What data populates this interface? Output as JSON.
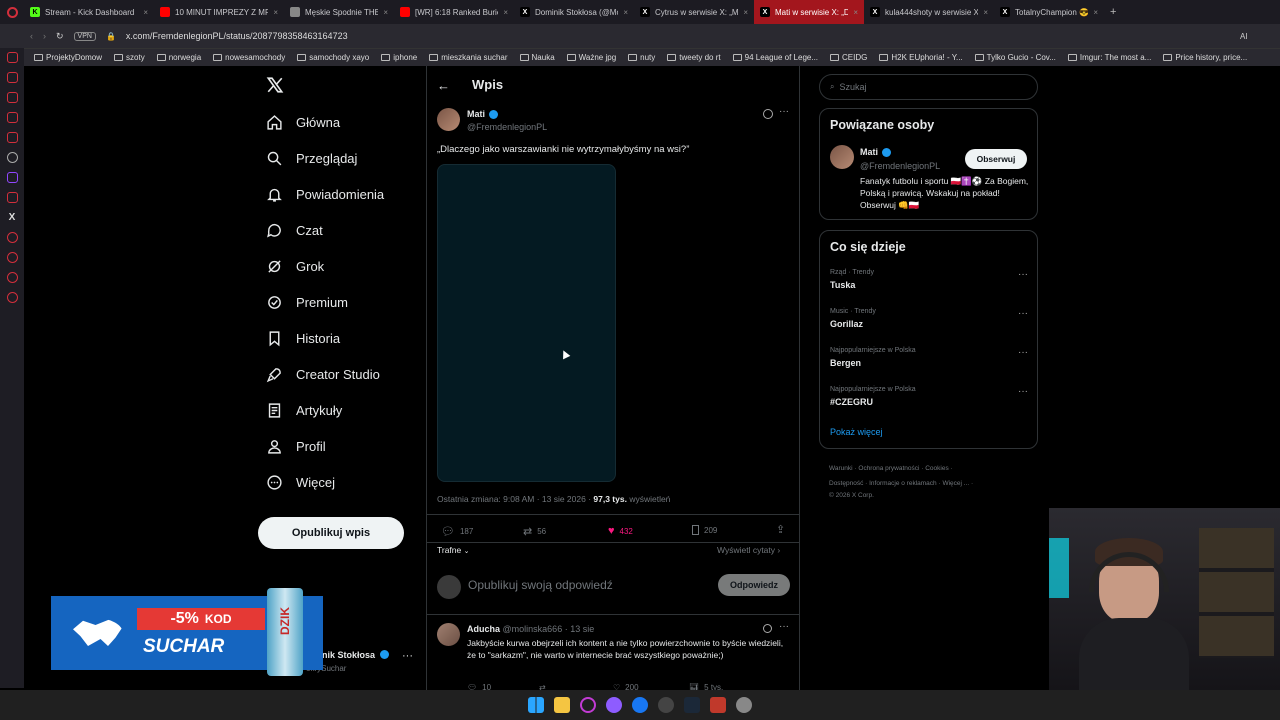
{
  "tabs": [
    {
      "label": "Stream - Kick Dashboard",
      "fav": "K",
      "color": "#53fc18",
      "active": false
    },
    {
      "label": "10 MINUT IMPREZY Z MR",
      "fav": "",
      "color": "#ff0000",
      "active": false
    },
    {
      "label": "Męskie Spodnie THE NOR",
      "fav": "",
      "color": "#888",
      "active": false
    },
    {
      "label": "[WR] 6:18 Ranked Buried T",
      "fav": "",
      "color": "#ff0000",
      "active": false
    },
    {
      "label": "Dominik Stokłosa (@Mokr",
      "fav": "X",
      "color": "#000",
      "active": false
    },
    {
      "label": "Cytrus w serwisie X: „Man",
      "fav": "X",
      "color": "#000",
      "active": false
    },
    {
      "label": "Mati w serwisie X: „Dlacz",
      "fav": "X",
      "color": "#000",
      "active": true
    },
    {
      "label": "kula444shoty w serwisie X",
      "fav": "X",
      "color": "#000",
      "active": false
    },
    {
      "label": "TotalnyChampion 😎👊 w",
      "fav": "X",
      "color": "#000",
      "active": false
    }
  ],
  "url": "x.com/FremdenlegionPL/status/2087798358463164723",
  "vpn": "VPN",
  "ai": "AI",
  "bookmarks": [
    "ProjektyDomow",
    "szoty",
    "norwegia",
    "nowesamochody",
    "samochody xayo",
    "iphone",
    "mieszkania suchar",
    "Nauka",
    "Ważne jpg",
    "nuty",
    "tweety do rt",
    "94 League of Lege...",
    "CEIDG",
    "H2K EUphoria! - Y...",
    "Tylko Gucio - Cov...",
    "Imgur: The most a...",
    "Price history, price..."
  ],
  "nav": [
    {
      "label": "Główna",
      "icon": "home-icon"
    },
    {
      "label": "Przeglądaj",
      "icon": "search-icon"
    },
    {
      "label": "Powiadomienia",
      "icon": "bell-icon"
    },
    {
      "label": "Czat",
      "icon": "chat-icon"
    },
    {
      "label": "Grok",
      "icon": "grok-icon"
    },
    {
      "label": "Premium",
      "icon": "premium-icon"
    },
    {
      "label": "Historia",
      "icon": "bookmark-icon"
    },
    {
      "label": "Creator Studio",
      "icon": "rocket-icon"
    },
    {
      "label": "Artykuły",
      "icon": "article-icon"
    },
    {
      "label": "Profil",
      "icon": "person-icon"
    },
    {
      "label": "Więcej",
      "icon": "more-icon"
    }
  ],
  "post_button": "Opublikuj wpis",
  "account": {
    "name": "nik Stokłosa",
    "handle": "okrySuchar"
  },
  "header": {
    "title": "Wpis"
  },
  "post": {
    "name": "Mati",
    "handle": "@FremdenlegionPL",
    "text": "„Dlaczego jako warszawianki nie wytrzymałybyśmy na wsi?”",
    "meta_prefix": "Ostatnia zmiana: 9:08 AM · 13 sie 2026 · ",
    "views": "97,3 tys.",
    "views_label": " wyświetleń",
    "replies": "187",
    "reposts": "56",
    "likes": "432",
    "bookmarks": "209",
    "sort": "Trafne",
    "quotes": "Wyświetl cytaty"
  },
  "reply_box": {
    "placeholder": "Opublikuj swoją odpowiedź",
    "button": "Odpowiedz"
  },
  "reply": {
    "name": "Aducha",
    "handle": "@molinska666",
    "time": "· 13 sie",
    "text": "Jakbyście kurwa obejrzeli ich kontent a nie tylko powierzchownie to byście wiedzieli, że to \"sarkazm\", nie warto w internecie brać wszystkiego poważnie;)",
    "replies": "10",
    "likes": "200",
    "views": "5 tys."
  },
  "search": {
    "placeholder": "Szukaj"
  },
  "related": {
    "title": "Powiązane osoby",
    "name": "Mati",
    "handle": "@FremdenlegionPL",
    "follow": "Obserwuj",
    "bio": "Fanatyk futbolu i sportu 🇵🇱✝️⚽ Za Bogiem, Polską i prawicą. Wskakuj na pokład! Obserwuj 👊🇵🇱"
  },
  "trends": {
    "title": "Co się dzieje",
    "items": [
      {
        "context": "Rząd · Trendy",
        "name": "Tuska"
      },
      {
        "context": "Music · Trendy",
        "name": "Gorillaz"
      },
      {
        "context": "Najpopularniejsze w Polska",
        "name": "Bergen"
      },
      {
        "context": "Najpopularniejsze w Polska",
        "name": "#CZEGRU"
      }
    ],
    "more": "Pokaż więcej"
  },
  "footer": {
    "l1": [
      "Warunki",
      "Ochrona prywatności",
      "Cookies"
    ],
    "l2": [
      "Dostępność",
      "Informacje o reklamach",
      "Więcej ..."
    ],
    "copy": "© 2026 X Corp."
  },
  "promo": {
    "discount": "-5%",
    "kod": "KOD",
    "code": "SUCHAR",
    "can": "DZIK"
  },
  "colors": {
    "accent": "#1d9bf0",
    "like": "#f91880",
    "tab_active": "#a3161d"
  }
}
